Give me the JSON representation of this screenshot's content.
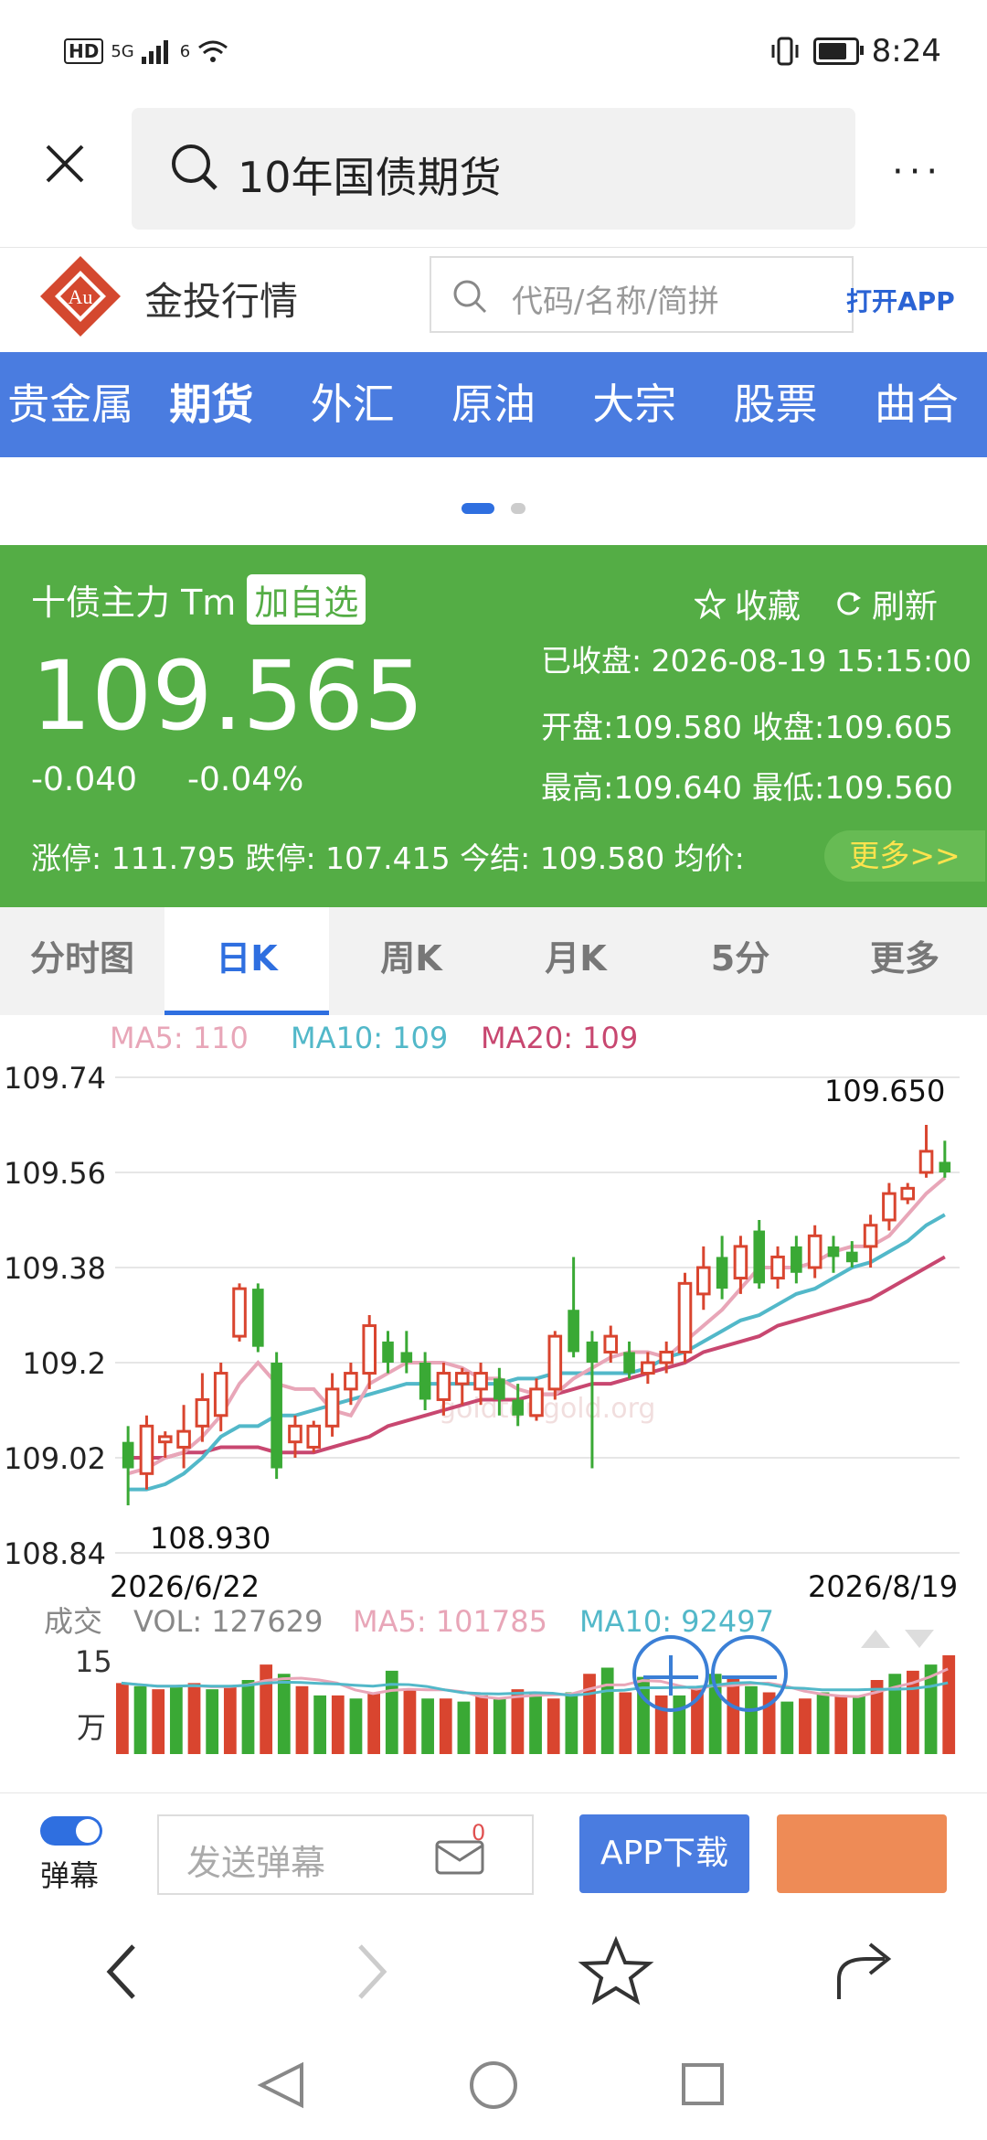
{
  "status_bar": {
    "hd": "HD",
    "network": "5G",
    "wifi_label": "6",
    "time": "8:24"
  },
  "browser_top": {
    "search_text": "10年国债期货",
    "more": "···"
  },
  "site": {
    "brand": "金投行情",
    "logo_text": "Au",
    "search_placeholder": "代码/名称/简拼",
    "open_app": "打开APP"
  },
  "nav": {
    "items": [
      "贵金属",
      "期货",
      "外汇",
      "原油",
      "大宗",
      "股票",
      "曲合"
    ],
    "active_index": 1
  },
  "quote": {
    "name": "十债主力 Tm",
    "add_watch": "加自选",
    "price": "109.565",
    "change": "-0.040",
    "change_pct": "-0.04%",
    "favorite": "收藏",
    "refresh": "刷新",
    "closed_status": "已收盘:  2026-08-19 15:15:00",
    "open_close": "开盘:109.580 收盘:109.605",
    "high_low": "最高:109.640 最低:109.560",
    "limits": "涨停:  111.795   跌停:  107.415   今结:  109.580   均价:",
    "more": "更多>>",
    "colors": {
      "panel": "#54ad45",
      "more_text": "#ffe34d"
    }
  },
  "tabs": {
    "items": [
      "分时图",
      "日K",
      "周K",
      "月K",
      "5分",
      "更多"
    ],
    "active_index": 1
  },
  "chart_data": {
    "type": "candlestick",
    "ma_labels": {
      "ma5": "MA5: 110",
      "ma10": "MA10: 109",
      "ma20": "MA20: 109"
    },
    "y_ticks": [
      "109.74",
      "109.56",
      "109.38",
      "109.2",
      "109.02",
      "108.84"
    ],
    "y_tick_values": [
      109.74,
      109.56,
      109.38,
      109.2,
      109.02,
      108.84
    ],
    "ylim": [
      108.84,
      109.74
    ],
    "high_label": "109.650",
    "low_label": "108.930",
    "x_start": "2026/6/22",
    "x_end": "2026/8/19",
    "candles": [
      [
        109.05,
        109.0,
        109.08,
        108.93
      ],
      [
        108.99,
        109.08,
        109.1,
        108.96
      ],
      [
        109.05,
        109.06,
        109.07,
        109.02
      ],
      [
        109.04,
        109.07,
        109.12,
        109.0
      ],
      [
        109.08,
        109.13,
        109.18,
        109.05
      ],
      [
        109.1,
        109.18,
        109.2,
        109.07
      ],
      [
        109.25,
        109.34,
        109.35,
        109.24
      ],
      [
        109.34,
        109.23,
        109.35,
        109.22
      ],
      [
        109.2,
        109.0,
        109.22,
        108.98
      ],
      [
        109.05,
        109.08,
        109.1,
        109.02
      ],
      [
        109.04,
        109.08,
        109.09,
        109.03
      ],
      [
        109.08,
        109.15,
        109.18,
        109.06
      ],
      [
        109.15,
        109.18,
        109.2,
        109.12
      ],
      [
        109.18,
        109.27,
        109.29,
        109.15
      ],
      [
        109.24,
        109.2,
        109.26,
        109.18
      ],
      [
        109.22,
        109.2,
        109.26,
        109.18
      ],
      [
        109.2,
        109.13,
        109.22,
        109.11
      ],
      [
        109.13,
        109.18,
        109.2,
        109.1
      ],
      [
        109.16,
        109.18,
        109.19,
        109.12
      ],
      [
        109.15,
        109.18,
        109.2,
        109.12
      ],
      [
        109.17,
        109.13,
        109.19,
        109.1
      ],
      [
        109.13,
        109.1,
        109.16,
        109.08
      ],
      [
        109.1,
        109.15,
        109.17,
        109.09
      ],
      [
        109.15,
        109.25,
        109.26,
        109.13
      ],
      [
        109.3,
        109.22,
        109.4,
        109.21
      ],
      [
        109.24,
        109.2,
        109.26,
        109.0
      ],
      [
        109.22,
        109.25,
        109.27,
        109.2
      ],
      [
        109.22,
        109.18,
        109.24,
        109.17
      ],
      [
        109.18,
        109.2,
        109.22,
        109.16
      ],
      [
        109.2,
        109.22,
        109.24,
        109.18
      ],
      [
        109.22,
        109.35,
        109.37,
        109.2
      ],
      [
        109.33,
        109.38,
        109.42,
        109.3
      ],
      [
        109.4,
        109.34,
        109.44,
        109.32
      ],
      [
        109.36,
        109.42,
        109.44,
        109.33
      ],
      [
        109.45,
        109.35,
        109.47,
        109.34
      ],
      [
        109.36,
        109.4,
        109.42,
        109.34
      ],
      [
        109.42,
        109.37,
        109.44,
        109.35
      ],
      [
        109.38,
        109.44,
        109.46,
        109.36
      ],
      [
        109.42,
        109.4,
        109.44,
        109.37
      ],
      [
        109.41,
        109.39,
        109.43,
        109.38
      ],
      [
        109.42,
        109.46,
        109.48,
        109.38
      ],
      [
        109.47,
        109.52,
        109.54,
        109.45
      ],
      [
        109.51,
        109.53,
        109.54,
        109.5
      ],
      [
        109.56,
        109.6,
        109.65,
        109.55
      ],
      [
        109.58,
        109.56,
        109.62,
        109.55
      ]
    ],
    "ma_lines": {
      "ma5": [
        108.99,
        109.0,
        109.02,
        109.03,
        109.06,
        109.1,
        109.16,
        109.2,
        109.16,
        109.15,
        109.15,
        109.11,
        109.1,
        109.16,
        109.18,
        109.2,
        109.2,
        109.2,
        109.19,
        109.17,
        109.17,
        109.15,
        109.14,
        109.14,
        109.17,
        109.19,
        109.21,
        109.22,
        109.22,
        109.21,
        109.24,
        109.27,
        109.3,
        109.34,
        109.38,
        109.38,
        109.38,
        109.39,
        109.41,
        109.42,
        109.42,
        109.44,
        109.48,
        109.52,
        109.55
      ],
      "ma10": [
        108.96,
        108.96,
        108.97,
        108.99,
        109.02,
        109.06,
        109.08,
        109.08,
        109.1,
        109.1,
        109.11,
        109.12,
        109.13,
        109.14,
        109.15,
        109.16,
        109.16,
        109.16,
        109.16,
        109.16,
        109.16,
        109.17,
        109.17,
        109.18,
        109.18,
        109.18,
        109.18,
        109.18,
        109.19,
        109.21,
        109.22,
        109.24,
        109.26,
        109.28,
        109.29,
        109.31,
        109.33,
        109.34,
        109.36,
        109.38,
        109.39,
        109.41,
        109.43,
        109.46,
        109.48
      ],
      "ma20": [
        109.02,
        109.02,
        109.02,
        109.03,
        109.03,
        109.04,
        109.04,
        109.04,
        109.03,
        109.03,
        109.03,
        109.04,
        109.05,
        109.06,
        109.08,
        109.09,
        109.1,
        109.11,
        109.12,
        109.13,
        109.13,
        109.13,
        109.14,
        109.14,
        109.15,
        109.16,
        109.16,
        109.17,
        109.18,
        109.19,
        109.2,
        109.22,
        109.23,
        109.24,
        109.25,
        109.27,
        109.28,
        109.29,
        109.3,
        109.31,
        109.32,
        109.34,
        109.36,
        109.38,
        109.4
      ]
    },
    "volume": {
      "label": "成交",
      "vol": "VOL: 127629",
      "ma5": "MA5: 101785",
      "ma10": "MA10: 92497",
      "y_top": "15",
      "y_unit": "万",
      "values": [
        11.5,
        11,
        10.5,
        11,
        11.5,
        10.5,
        11,
        12,
        14.5,
        13,
        11,
        9.5,
        9.5,
        9,
        10,
        13.5,
        10.5,
        9,
        9,
        8.5,
        9.5,
        9,
        10.5,
        10,
        9,
        10,
        13,
        14,
        10,
        12.5,
        9.5,
        9.5,
        11,
        13,
        12.5,
        11,
        10,
        8.5,
        9,
        10,
        9.5,
        9.5,
        12,
        13,
        13.5,
        14.5,
        16
      ]
    },
    "watermark": "goldtougold.org",
    "colors": {
      "up": "#d9452f",
      "down": "#3aa935",
      "ma5": "#e8a6b8",
      "ma10": "#52b8c9",
      "ma20": "#c84770"
    }
  },
  "bottom_bar": {
    "danmu_label": "弹幕",
    "danmu_placeholder": "发送弹幕",
    "mail_count": "0",
    "app_download": "APP下载"
  }
}
